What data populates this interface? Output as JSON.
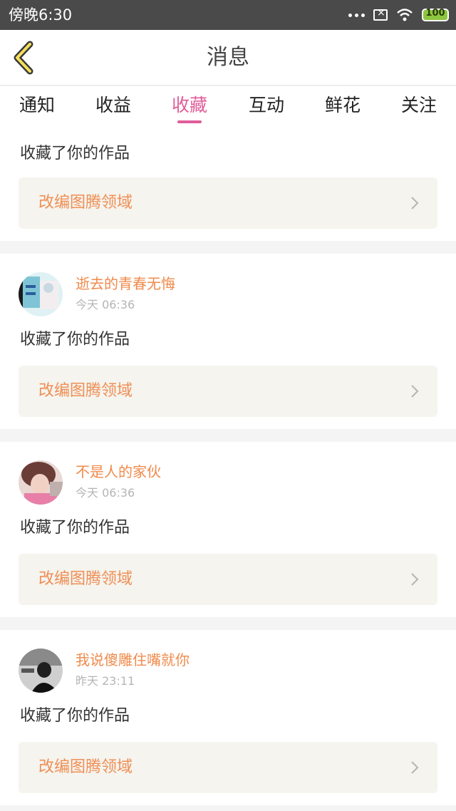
{
  "status_bar": {
    "time": "傍晚6:30",
    "battery": "100"
  },
  "nav": {
    "title": "消息"
  },
  "tabs": [
    {
      "label": "通知"
    },
    {
      "label": "收益"
    },
    {
      "label": "收藏",
      "active": true
    },
    {
      "label": "互动"
    },
    {
      "label": "鲜花"
    },
    {
      "label": "关注"
    }
  ],
  "items": [
    {
      "action": "收藏了你的作品",
      "work": "改编图腾领域"
    },
    {
      "user": "逝去的青春无悔",
      "time": "今天 06:36",
      "action": "收藏了你的作品",
      "work": "改编图腾领域"
    },
    {
      "user": "不是人的家伙",
      "time": "今天 06:36",
      "action": "收藏了你的作品",
      "work": "改编图腾领域"
    },
    {
      "user": "我说傻雕住嘴就你",
      "time": "昨天 23:11",
      "action": "收藏了你的作品",
      "work": "改编图腾领域"
    }
  ],
  "colors": {
    "accent": "#e05d9a",
    "name": "#f08a4b",
    "work": "#ef8e55"
  }
}
